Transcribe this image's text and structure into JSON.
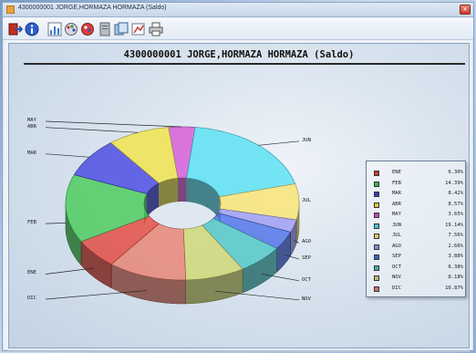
{
  "window": {
    "title": "4300000001  JORGE,HORMAZA HORMAZA  (Saldo)",
    "close_label": "x"
  },
  "toolbar": {
    "icons": [
      "exit-icon",
      "info-icon",
      "chart-icon",
      "palette-icon",
      "red-palette-icon",
      "page-icon",
      "gallery-icon",
      "export-chart-icon",
      "print-icon"
    ]
  },
  "report": {
    "heading": "4300000001  JORGE,HORMAZA HORMAZA  (Saldo)"
  },
  "colors": {
    "ENE": "#cc3a30",
    "FEB": "#3cb54a",
    "MAR": "#3a3ac8",
    "ABR": "#d8cc3a",
    "MAY": "#c04ac0",
    "JUN": "#48c8d8",
    "JUL": "#e0cc60",
    "AGO": "#8a88d8",
    "SEP": "#4060d0",
    "OCT": "#40b0b0",
    "NOV": "#b8c060",
    "DIC": "#d07060"
  },
  "chart_data": {
    "type": "pie",
    "style": "3d-donut",
    "categories": [
      "ENE",
      "FEB",
      "MAR",
      "ABR",
      "MAY",
      "JUN",
      "JUL",
      "AGO",
      "SEP",
      "OCT",
      "NOV",
      "DIC"
    ],
    "values": [
      6.3,
      14.39,
      8.42,
      8.57,
      3.65,
      19.14,
      7.56,
      2.66,
      3.88,
      6.38,
      8.18,
      10.87
    ],
    "value_labels": [
      "6.30%",
      "14.39%",
      "8.42%",
      "8.57%",
      "3.65%",
      "19.14%",
      "7.56%",
      "2.66%",
      "3.88%",
      "6.38%",
      "8.18%",
      "10.87%"
    ],
    "legend": "right"
  }
}
